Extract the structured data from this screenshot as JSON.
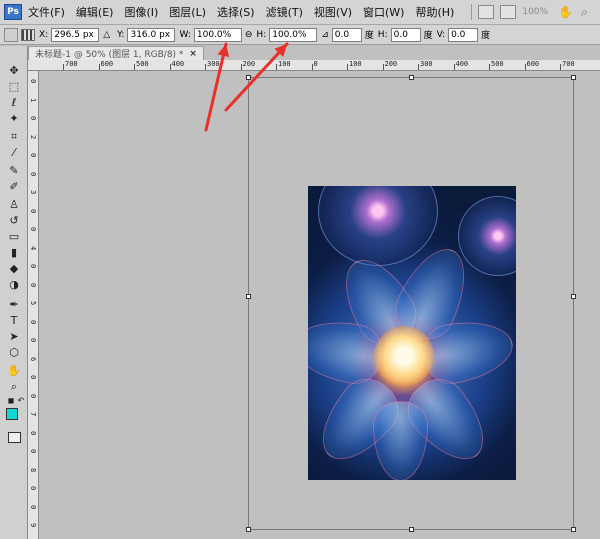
{
  "app": {
    "logo": "Ps"
  },
  "menu": [
    "文件(F)",
    "编辑(E)",
    "图像(I)",
    "图层(L)",
    "选择(S)",
    "滤镜(T)",
    "视图(V)",
    "窗口(W)",
    "帮助(H)"
  ],
  "menubar_extra": {
    "zoom": "100%"
  },
  "options": {
    "x_label": "X:",
    "x_value": "296.5 px",
    "y_label": "Y:",
    "y_value": "316.0 px",
    "w_label": "W:",
    "w_value": "100.0%",
    "h_label": "H:",
    "h_value": "100.0%",
    "angle_value": "0.0",
    "angle_unit": "度",
    "hskew_label": "H:",
    "hskew_value": "0.0",
    "hskew_unit": "度",
    "vskew_label": "V:",
    "vskew_value": "0.0",
    "vskew_unit": "度"
  },
  "document": {
    "tab_title": "未标题-1 @ 50% (图层 1, RGB/8) *",
    "close_glyph": "×"
  },
  "ruler": {
    "top_labels": [
      "700",
      "600",
      "500",
      "400",
      "300",
      "200",
      "100",
      "0",
      "100",
      "200",
      "300",
      "400",
      "500",
      "600",
      "700"
    ],
    "left_labels": [
      "0",
      "1",
      "0",
      "2",
      "0",
      "0",
      "3",
      "0",
      "0",
      "4",
      "0",
      "0",
      "5",
      "0",
      "0",
      "6",
      "0",
      "0",
      "7",
      "0",
      "0",
      "8",
      "0",
      "0",
      "9"
    ]
  },
  "colors": {
    "foreground": "#14d8d0",
    "background": "#ffffff",
    "arrow": "#e8302a"
  },
  "tools": [
    "move-icon",
    "marquee-icon",
    "lasso-icon",
    "magic-wand-icon",
    "crop-icon",
    "eyedropper-icon",
    "healing-brush-icon",
    "brush-icon",
    "clone-stamp-icon",
    "history-brush-icon",
    "eraser-icon",
    "gradient-icon",
    "blur-icon",
    "dodge-icon",
    "pen-icon",
    "type-icon",
    "path-selection-icon",
    "shape-icon",
    "hand-icon",
    "zoom-icon"
  ]
}
